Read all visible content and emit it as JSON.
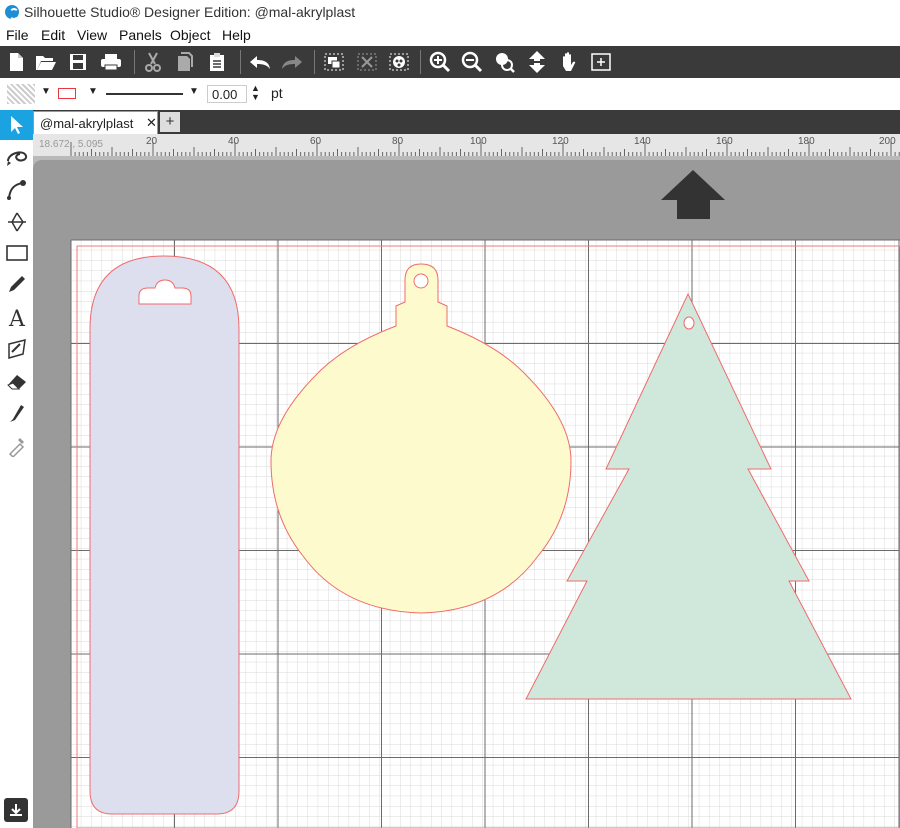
{
  "window": {
    "title": "Silhouette Studio® Designer Edition: @mal-akrylplast"
  },
  "menu": [
    "File",
    "Edit",
    "View",
    "Panels",
    "Object",
    "Help"
  ],
  "toolbar": {
    "icons": [
      "new-document-icon",
      "open-folder-icon",
      "save-icon",
      "print-icon",
      "cut-icon",
      "copy-icon",
      "paste-icon",
      "undo-icon",
      "redo-icon",
      "group-icon",
      "ungroup-icon",
      "compound-path-icon",
      "zoom-in-icon",
      "zoom-out-icon",
      "zoom-select-icon",
      "fit-to-page-icon",
      "pan-hand-icon",
      "zoom-fit-icon"
    ]
  },
  "line_options": {
    "line_width": "0.00",
    "unit": "pt",
    "line_color": "#e8373d"
  },
  "tabs": [
    {
      "label": "@mal-akrylplast",
      "close": "✕"
    }
  ],
  "new_tab": "+",
  "ruler": {
    "coordinates": "18.672 , 5.095",
    "ticks": [
      "20",
      "40",
      "60",
      "80",
      "100",
      "120",
      "140",
      "160",
      "180",
      "200"
    ]
  },
  "colors": {
    "tag_fill": "#dddfee",
    "ornament_fill": "#fdfbcd",
    "tree_fill": "#d0e7dc",
    "cut_line": "#f06b6b",
    "cutting_mat": "#b9b9b9"
  }
}
